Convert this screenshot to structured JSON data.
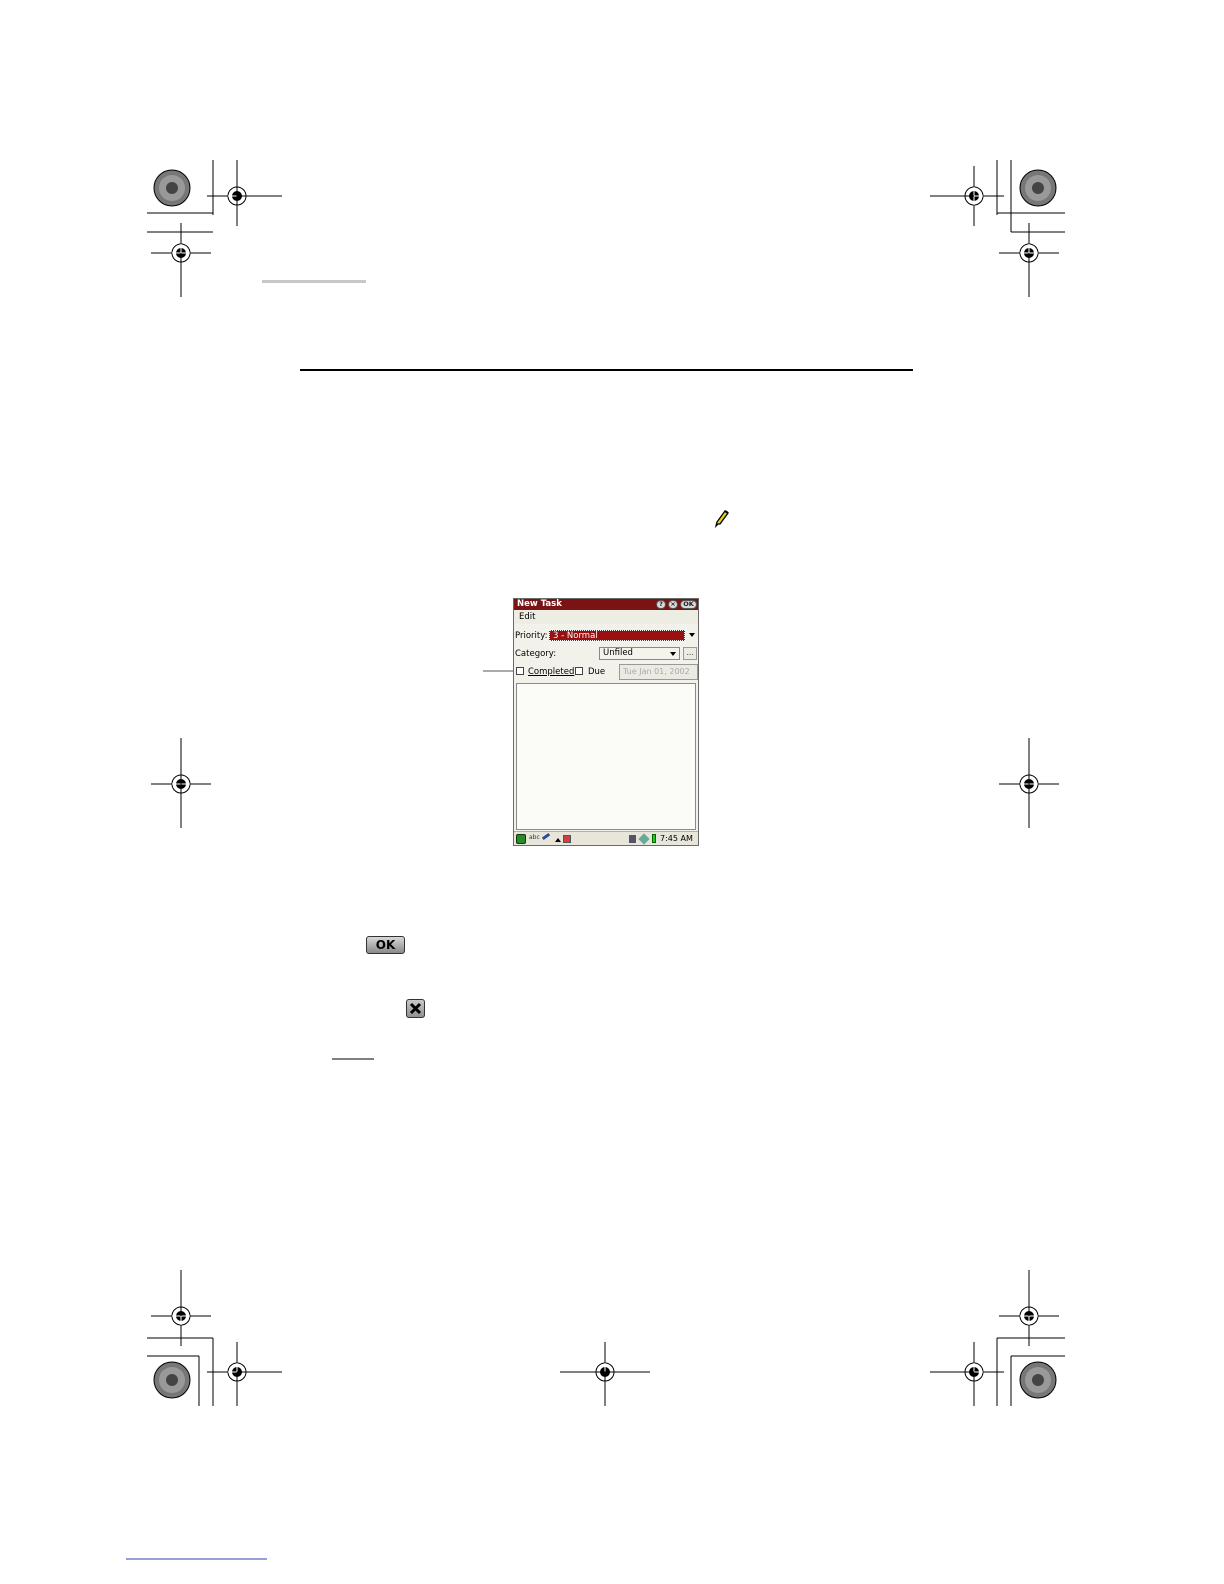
{
  "pda": {
    "title": "New Task",
    "menu_edit": "Edit",
    "priority_label": "Priority:",
    "priority_value": "3 - Normal",
    "category_label": "Category:",
    "category_value": "Unfiled",
    "category_more": "...",
    "completed_label": "Completed",
    "due_label": "Due",
    "due_date": "Tue Jan 01, 2002",
    "time": "7:45 AM",
    "ok_label": "OK",
    "input_mode": "abc"
  },
  "inline_icons": {
    "ok_label": "OK"
  },
  "colors": {
    "titlebar": "#7a1414",
    "priority_bg": "#9a1010",
    "rule": "#000000"
  }
}
